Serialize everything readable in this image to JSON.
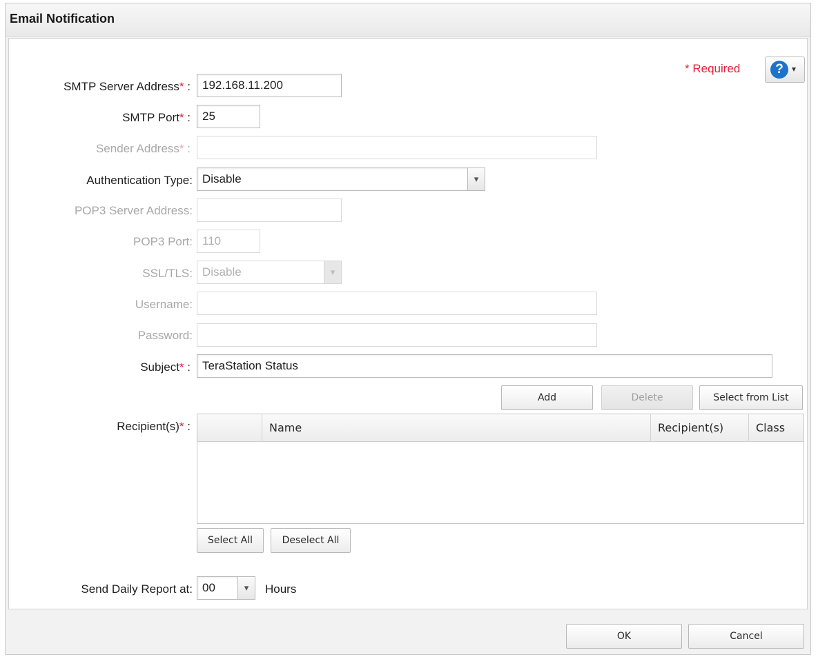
{
  "dialog": {
    "title": "Email Notification",
    "required_note": "* Required",
    "help_icon": "question-circle-icon"
  },
  "form": {
    "smtp_server": {
      "label": "SMTP Server Address",
      "suffix": " :",
      "value": "192.168.11.200"
    },
    "smtp_port": {
      "label": "SMTP Port",
      "suffix": " :",
      "value": "25"
    },
    "sender": {
      "label": "Sender Address",
      "suffix": " :",
      "value": ""
    },
    "auth_type": {
      "label": "Authentication Type:",
      "value": "Disable"
    },
    "pop3_server": {
      "label": "POP3 Server Address:",
      "value": ""
    },
    "pop3_port": {
      "label": "POP3 Port:",
      "value": "110"
    },
    "ssl_tls": {
      "label": "SSL/TLS:",
      "value": "Disable"
    },
    "username": {
      "label": "Username:",
      "value": ""
    },
    "password": {
      "label": "Password:",
      "value": ""
    },
    "subject": {
      "label": "Subject",
      "suffix": " :",
      "value": "TeraStation Status"
    },
    "recipients": {
      "label": "Recipient(s)",
      "suffix": " :"
    },
    "daily_report": {
      "label": "Send Daily Report at:",
      "value": "00",
      "unit": "Hours"
    }
  },
  "recipients_toolbar": {
    "add": "Add",
    "delete": "Delete",
    "select_from_list": "Select from List"
  },
  "recipients_table": {
    "columns": [
      "",
      "Name",
      "Recipient(s)",
      "Class"
    ],
    "rows": []
  },
  "selection": {
    "select_all": "Select All",
    "deselect_all": "Deselect All"
  },
  "footer": {
    "ok": "OK",
    "cancel": "Cancel"
  }
}
